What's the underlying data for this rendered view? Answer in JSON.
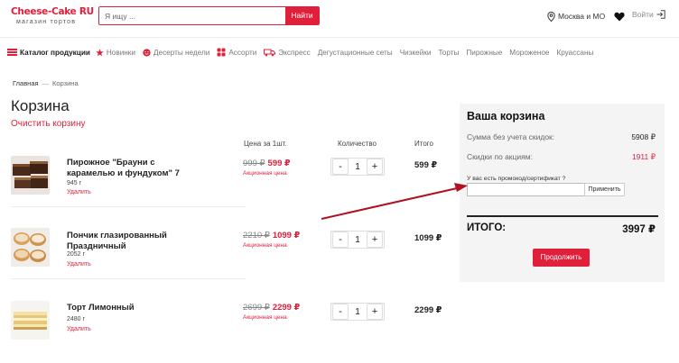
{
  "header": {
    "logo_main": "Cheese-Cake RU",
    "logo_sub": "магазин тортов",
    "search_placeholder": "Я ищу ...",
    "search_button": "Найти",
    "location": "Москва и МО",
    "login": "Войти",
    "colors": {
      "accent": "#e0203a"
    }
  },
  "nav": {
    "catalog": "Каталог продукции",
    "items": [
      "Новинки",
      "Десерты недели",
      "Ассорти",
      "Экспресс",
      "Дегустационные сеты",
      "Чизкейки",
      "Торты",
      "Пирожные",
      "Мороженое",
      "Круассаны"
    ],
    "icons": [
      "star-icon",
      "smile-icon",
      "grid-icon",
      "truck-icon"
    ]
  },
  "breadcrumb": {
    "home": "Главная",
    "separator": "—",
    "current": "Корзина"
  },
  "cart": {
    "title": "Корзина",
    "clear": "Очистить корзину",
    "columns": {
      "price": "Цена за 1шт.",
      "qty": "Количество",
      "total": "Итого"
    },
    "items": [
      {
        "name": "Пирожное \"Брауни с карамелью и фундуком\" 7",
        "weight": "945 г",
        "delete": "Удалить",
        "old_price": "999 ₽",
        "price": "599 ₽",
        "note": "Акционная цена",
        "qty": "1",
        "total": "599 ₽"
      },
      {
        "name": "Пончик глазированный Праздничный",
        "weight": "2052 г",
        "delete": "Удалить",
        "old_price": "2210 ₽",
        "price": "1099 ₽",
        "note": "Акционная цена",
        "qty": "1",
        "total": "1099 ₽"
      },
      {
        "name": "Торт Лимонный",
        "weight": "2480 г",
        "delete": "Удалить",
        "old_price": "2699 ₽",
        "price": "2299 ₽",
        "note": "Акционная цена",
        "qty": "1",
        "total": "2299 ₽"
      }
    ],
    "minus": "-",
    "plus": "+"
  },
  "summary": {
    "title": "Ваша корзина",
    "subtotal_label": "Сумма без учета скидок:",
    "subtotal": "5908 ₽",
    "discount_label": "Скидки по акциям:",
    "discount": "1911 ₽",
    "promo_label": "У вас есть промокод/сертификат ?",
    "promo_value": "",
    "apply": "Применить",
    "grand_label": "ИТОГО:",
    "grand_total": "3997 ₽",
    "continue": "Продолжить"
  }
}
